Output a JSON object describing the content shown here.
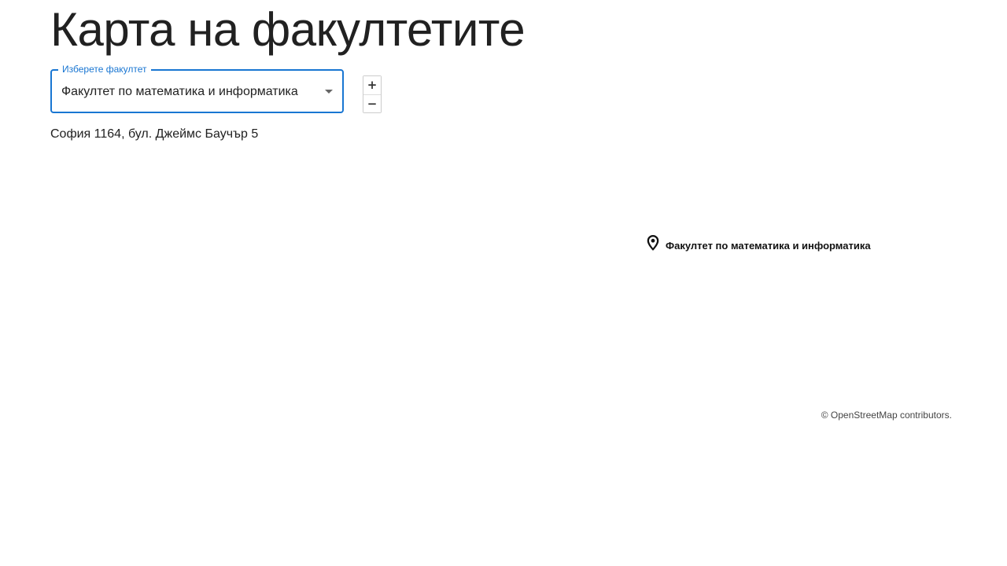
{
  "page": {
    "title": "Карта на факултетите"
  },
  "faculty_select": {
    "label": "Изберете факултет",
    "value": "Факултет по математика и информатика"
  },
  "zoom": {
    "in_label": "+",
    "out_label": "−"
  },
  "address": "София 1164, бул. Джеймс Баучър 5",
  "map": {
    "marker_icon": "map-pin-icon",
    "marker_label": "Факултет по математика и информатика",
    "attribution": {
      "prefix": "© ",
      "link": "OpenStreetMap",
      "suffix": " contributors."
    }
  },
  "colors": {
    "accent": "#1976d2",
    "text": "#212121"
  }
}
